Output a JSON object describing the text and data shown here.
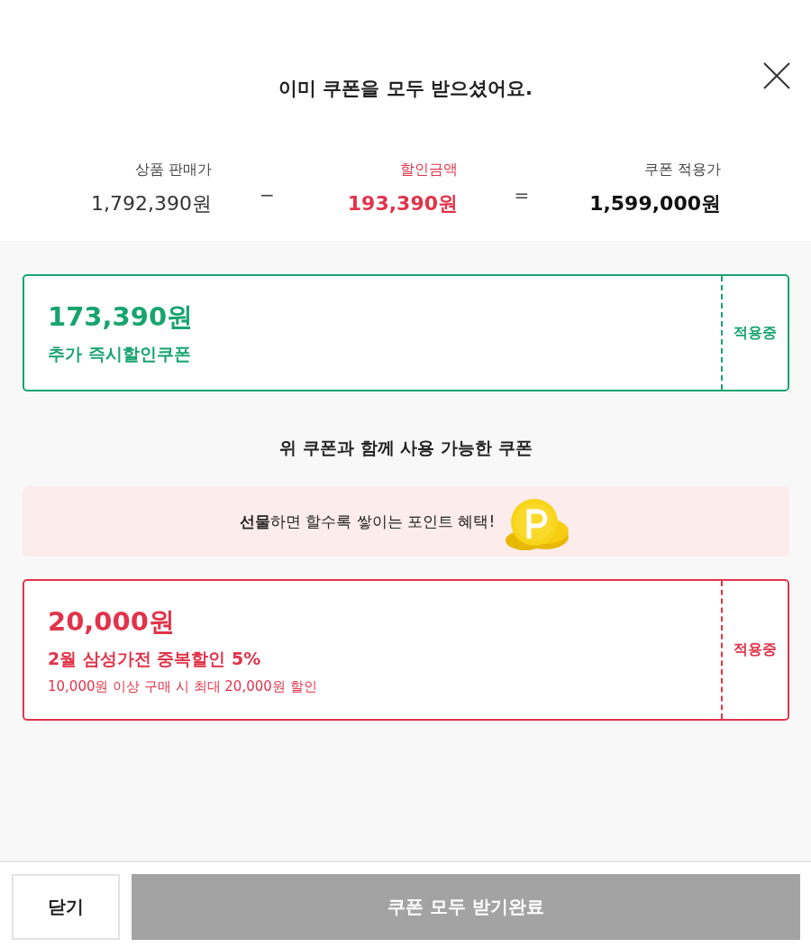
{
  "title": "이미 쿠폰을 모두 받으셨어요.",
  "summary": [
    {
      "label": "상품 판매가",
      "value": "1,792,390원",
      "kind": "price"
    },
    {
      "operator": "−"
    },
    {
      "label": "할인금액",
      "value": "193,390원",
      "kind": "discount"
    },
    {
      "operator": "="
    },
    {
      "label": "쿠폰 적용가",
      "value": "1,599,000원",
      "kind": "final"
    }
  ],
  "applied_coupons": [
    {
      "amount": "173,390원",
      "name": "추가 즉시할인쿠폰",
      "status": "적용중",
      "color": "#17a46f"
    }
  ],
  "section_title": "위 쿠폰과 함께 사용 가능한 쿠폰",
  "banner": {
    "text": "**선물**하면 할수록 쌓이는 포인트 혜택!"
  },
  "combinable_coupons": [
    {
      "amount": "20,000원",
      "name": "2월 삼성가전 중복할인 5%",
      "condition": "10,000원 이상 구매 시 최대 20,000원 할인",
      "status": "적용중",
      "color": "#e0344a"
    }
  ],
  "buttons": [
    {
      "label": "닫기",
      "kind": "secondary",
      "disabled": false
    },
    {
      "label": "쿠폰 모두 받기완료",
      "kind": "primary",
      "disabled": true
    }
  ]
}
